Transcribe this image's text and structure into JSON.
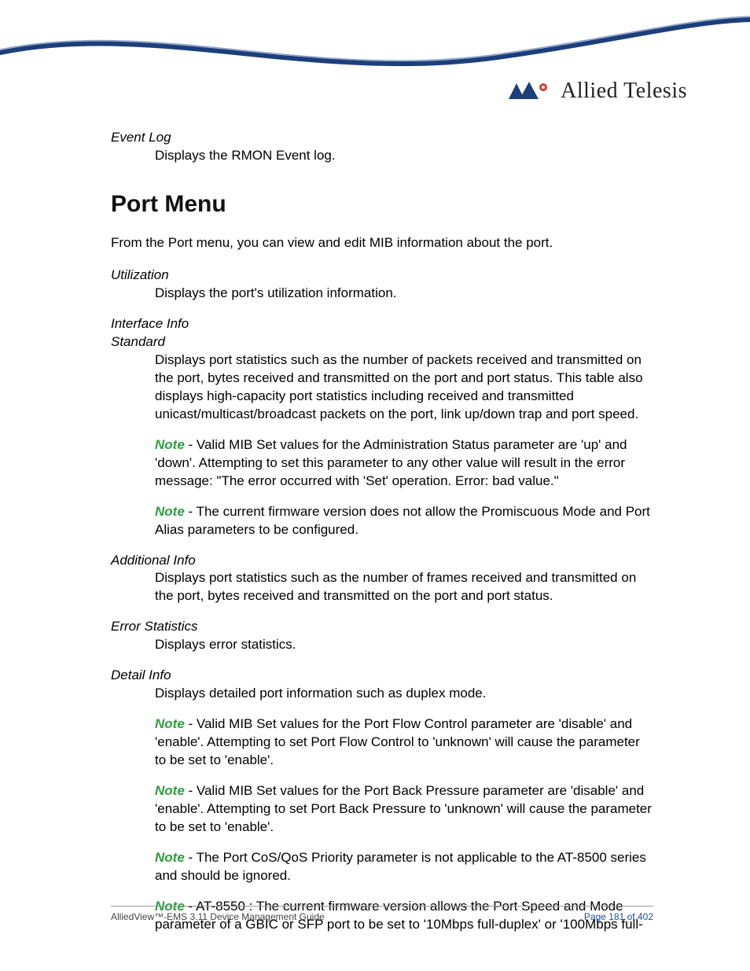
{
  "brand": {
    "name": "Allied Telesis"
  },
  "sections": {
    "event_log": {
      "term": "Event Log",
      "desc": "Displays the RMON Event log."
    },
    "port_menu": {
      "title": "Port Menu",
      "intro": "From the Port menu, you can view and edit MIB information about the port."
    },
    "utilization": {
      "term": "Utilization",
      "desc": "Displays the port's utilization information."
    },
    "interface_info": {
      "term": "Interface Info",
      "sub_term": "Standard",
      "desc": "Displays port statistics such as the number of packets received and transmitted on the port, bytes received and transmitted on the port and port status. This table also displays high-capacity port statistics including received and transmitted unicast/multicast/broadcast packets on the port, link up/down trap and port speed.",
      "note1": " - Valid MIB Set values for the Administration Status parameter are 'up' and 'down'. Attempting to set this parameter to any other value will result in the error message: \"The error occurred with 'Set' operation. Error: bad value.\"",
      "note2": " - The current firmware version does not allow the Promiscuous Mode and Port Alias parameters to be configured."
    },
    "additional_info": {
      "term": "Additional Info",
      "desc": "Displays port statistics such as the number of frames received and transmitted on the port, bytes received and transmitted on the port and port status."
    },
    "error_stats": {
      "term": "Error Statistics",
      "desc": "Displays error statistics."
    },
    "detail_info": {
      "term": "Detail Info",
      "desc": "Displays detailed port information such as duplex mode.",
      "note1": " - Valid MIB Set values for the Port Flow Control parameter are 'disable' and 'enable'. Attempting to set Port Flow Control to 'unknown' will cause the parameter to be set to 'enable'.",
      "note2": " - Valid MIB Set values for the Port Back Pressure parameter are 'disable' and 'enable'. Attempting to set Port Back Pressure to 'unknown' will cause the parameter to be set to 'enable'.",
      "note3": " - The Port CoS/QoS Priority parameter is not applicable to the AT-8500 series and should be ignored.",
      "note4": " - AT-8550 : The current firmware version allows the Port Speed and Mode parameter of a GBIC or SFP port to be set to '10Mbps full-duplex' or '100Mbps full-"
    }
  },
  "note_label": "Note",
  "footer": {
    "left": "AlliedView™-EMS 3.11 Device Management Guide",
    "right": "Page 181 of 402"
  }
}
